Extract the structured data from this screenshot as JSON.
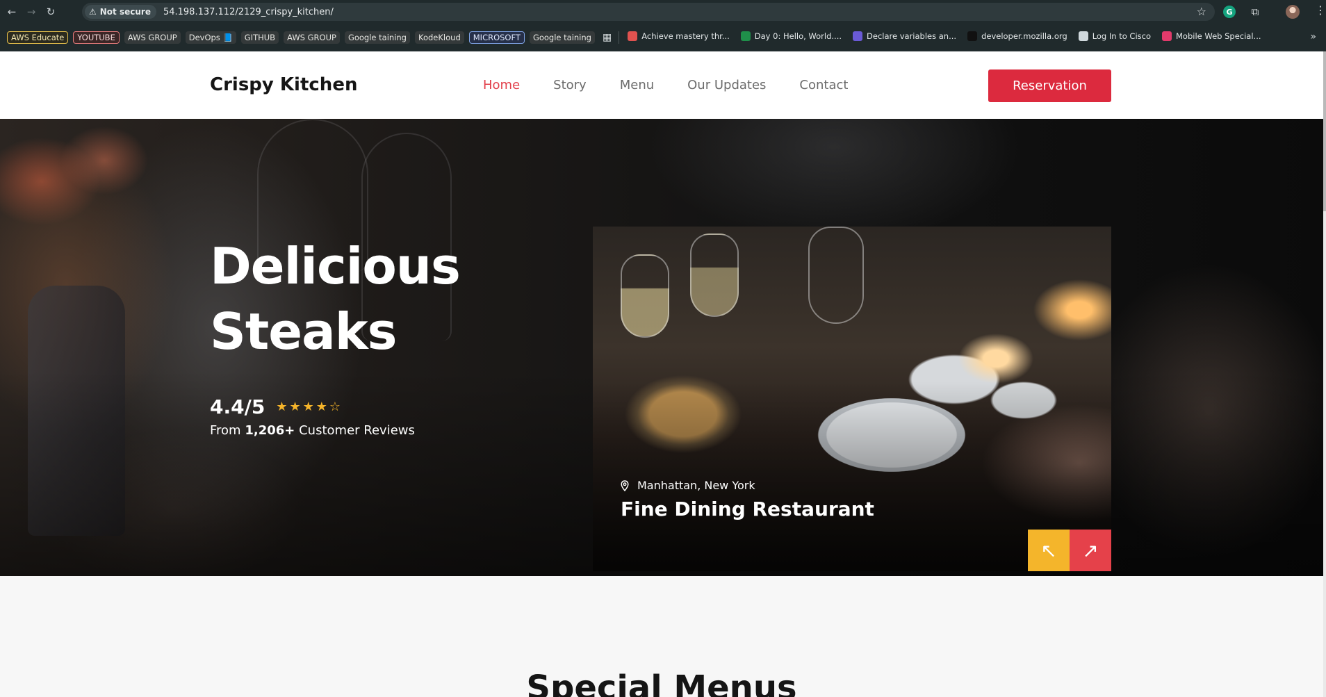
{
  "browser": {
    "security_label": "Not secure",
    "url": "54.198.137.112/2129_crispy_kitchen/",
    "bookmarks_chips": [
      {
        "label": "AWS Educate",
        "style": "outline-y"
      },
      {
        "label": "YOUTUBE",
        "style": "outline-r"
      },
      {
        "label": "AWS GROUP",
        "style": "plain"
      },
      {
        "label": "DevOps 📘",
        "style": "plain"
      },
      {
        "label": "GITHUB",
        "style": "plain"
      },
      {
        "label": "AWS GROUP",
        "style": "plain"
      },
      {
        "label": "Google taining",
        "style": "plain"
      },
      {
        "label": "KodeKloud",
        "style": "plain"
      },
      {
        "label": "MICROSOFT",
        "style": "outline-b"
      },
      {
        "label": "Google taining",
        "style": "plain"
      }
    ],
    "bookmarks_links": [
      {
        "label": "Achieve mastery thr...",
        "favicon_color": "#e0524f"
      },
      {
        "label": "Day 0: Hello, World....",
        "favicon_color": "#1f8f4a"
      },
      {
        "label": "Declare variables an...",
        "favicon_color": "#6a5ad6"
      },
      {
        "label": "developer.mozilla.org",
        "favicon_color": "#111111"
      },
      {
        "label": "Log In to Cisco",
        "favicon_color": "#cfd8dc"
      },
      {
        "label": "Mobile Web Special...",
        "favicon_color": "#e23a6b"
      }
    ]
  },
  "site": {
    "brand": "Crispy Kitchen",
    "nav": [
      "Home",
      "Story",
      "Menu",
      "Our Updates",
      "Contact"
    ],
    "active_nav": "Home",
    "reservation_label": "Reservation",
    "accent_color": "#dc2a3e"
  },
  "hero": {
    "title_line1": "Delicious",
    "title_line2": "Steaks",
    "rating_score": "4.4/5",
    "stars": 4.4,
    "reviews_prefix": "From",
    "reviews_count": "1,206+",
    "reviews_suffix": "Customer Reviews",
    "card_location": "Manhattan, New York",
    "card_title": "Fine Dining Restaurant",
    "prev_icon": "↖",
    "next_icon": "↗"
  },
  "sections": {
    "special_menus_title": "Special Menus"
  }
}
